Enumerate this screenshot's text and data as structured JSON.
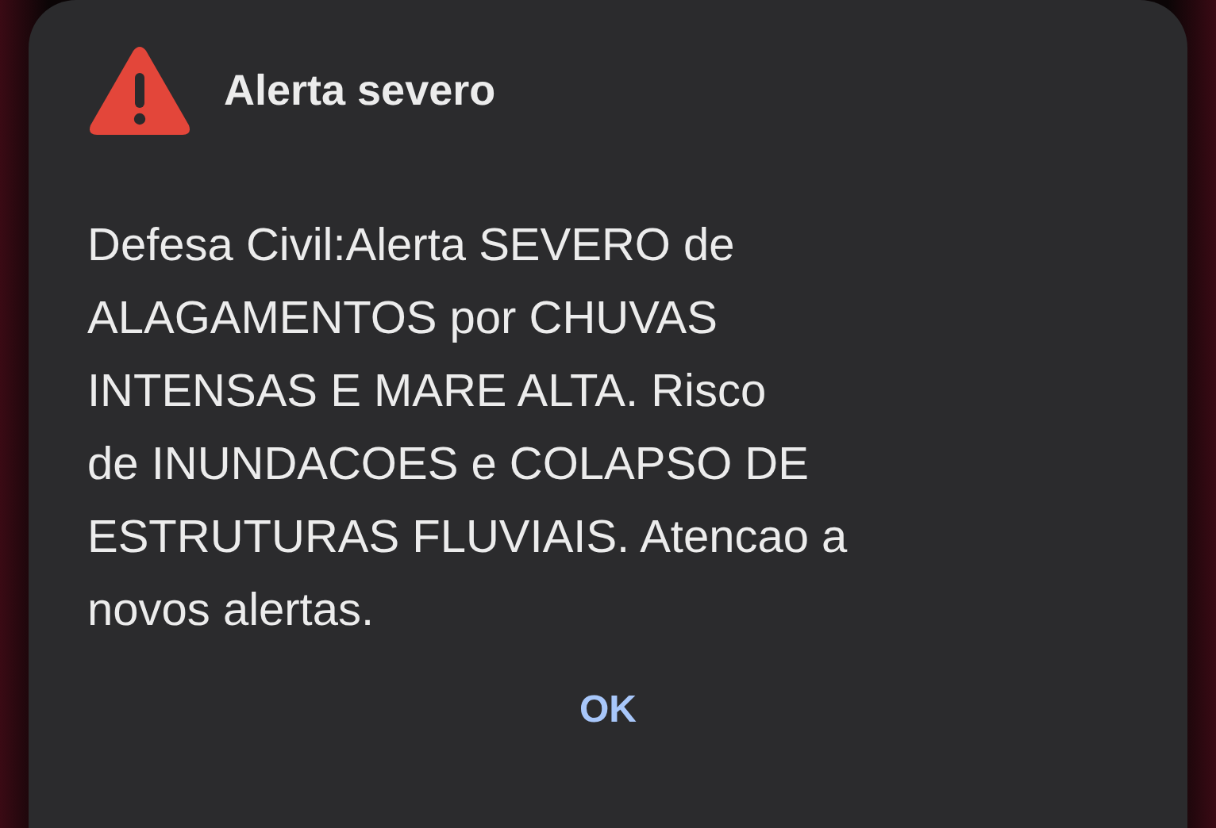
{
  "dialog": {
    "title": "Alerta severo",
    "message": "Defesa Civil:Alerta SEVERO de\nALAGAMENTOS por CHUVAS\nINTENSAS E MARE ALTA. Risco\nde INUNDACOES e COLAPSO DE\nESTRUTURAS FLUVIAIS. Atencao a\nnovos alertas.",
    "buttons": [
      "OK"
    ]
  }
}
